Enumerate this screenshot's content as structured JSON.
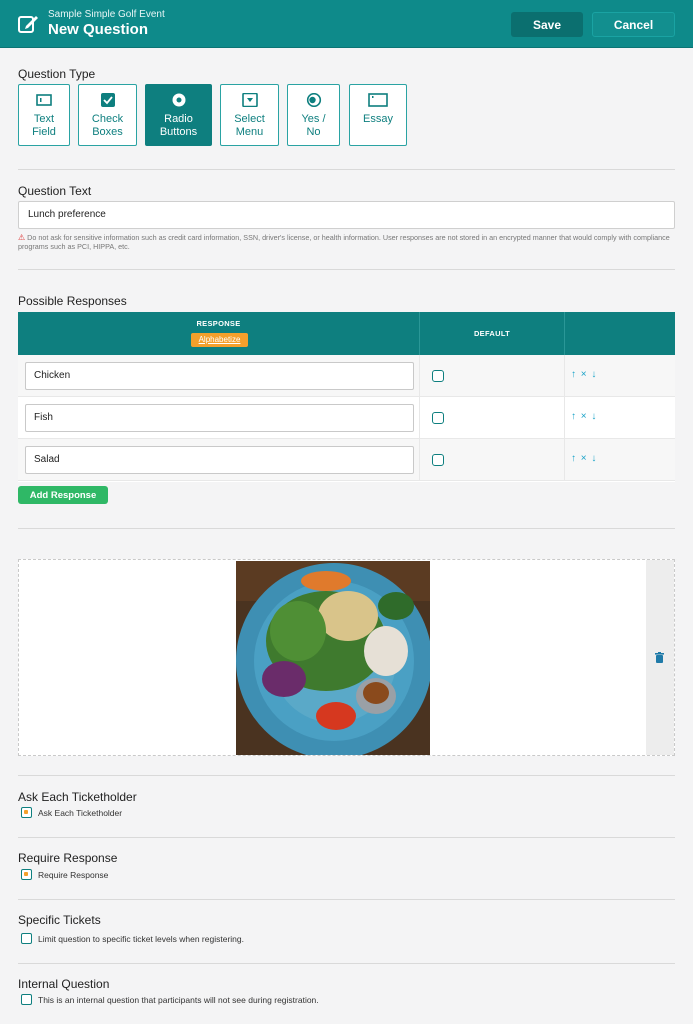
{
  "header": {
    "event_name": "Sample Simple Golf Event",
    "title": "New Question",
    "save_label": "Save",
    "cancel_label": "Cancel",
    "icon": "edit-icon",
    "color": "#0e8a8a"
  },
  "question_type": {
    "label": "Question Type",
    "options": [
      {
        "label": "Text\nField",
        "icon": "text-field-icon",
        "selected": false
      },
      {
        "label": "Check\nBoxes",
        "icon": "checkbox-icon",
        "selected": false
      },
      {
        "label": "Radio\nButtons",
        "icon": "radio-icon",
        "selected": true
      },
      {
        "label": "Select\nMenu",
        "icon": "select-menu-icon",
        "selected": false
      },
      {
        "label": "Yes /\nNo",
        "icon": "toggle-icon",
        "selected": false
      },
      {
        "label": "Essay",
        "icon": "essay-icon",
        "selected": false
      }
    ]
  },
  "question_text": {
    "label": "Question Text",
    "value": "Lunch preference",
    "warning": "Do not ask for sensitive information such as credit card information, SSN, driver's license, or health information. User responses are not stored in an encrypted manner that would comply with compliance programs such as PCI, HIPPA, etc."
  },
  "responses": {
    "label": "Possible Responses",
    "col_response": "RESPONSE",
    "alphabetize_label": "Alphabetize",
    "col_default": "DEFAULT",
    "rows": [
      {
        "value": "Chicken",
        "default": false
      },
      {
        "value": "Fish",
        "default": false
      },
      {
        "value": "Salad",
        "default": false
      }
    ],
    "row_actions": "↑ × ↓",
    "add_label": "Add Response"
  },
  "image": {
    "alt": "salad-photo",
    "delete_icon": "trash-icon"
  },
  "options": {
    "ask_each": {
      "title": "Ask Each Ticketholder",
      "checkbox_label": "Ask Each Ticketholder",
      "checked": true
    },
    "require": {
      "title": "Require Response",
      "checkbox_label": "Require Response",
      "checked": true
    },
    "specific": {
      "title": "Specific Tickets",
      "checkbox_label": "Limit question to specific ticket levels when registering.",
      "checked": false
    },
    "internal": {
      "title": "Internal Question",
      "checkbox_label": "This is an internal question that participants will not see during registration.",
      "checked": false
    }
  },
  "colors": {
    "primary": "#0e7f7f",
    "accent_orange": "#f4a02c",
    "add_green": "#2fb866"
  }
}
